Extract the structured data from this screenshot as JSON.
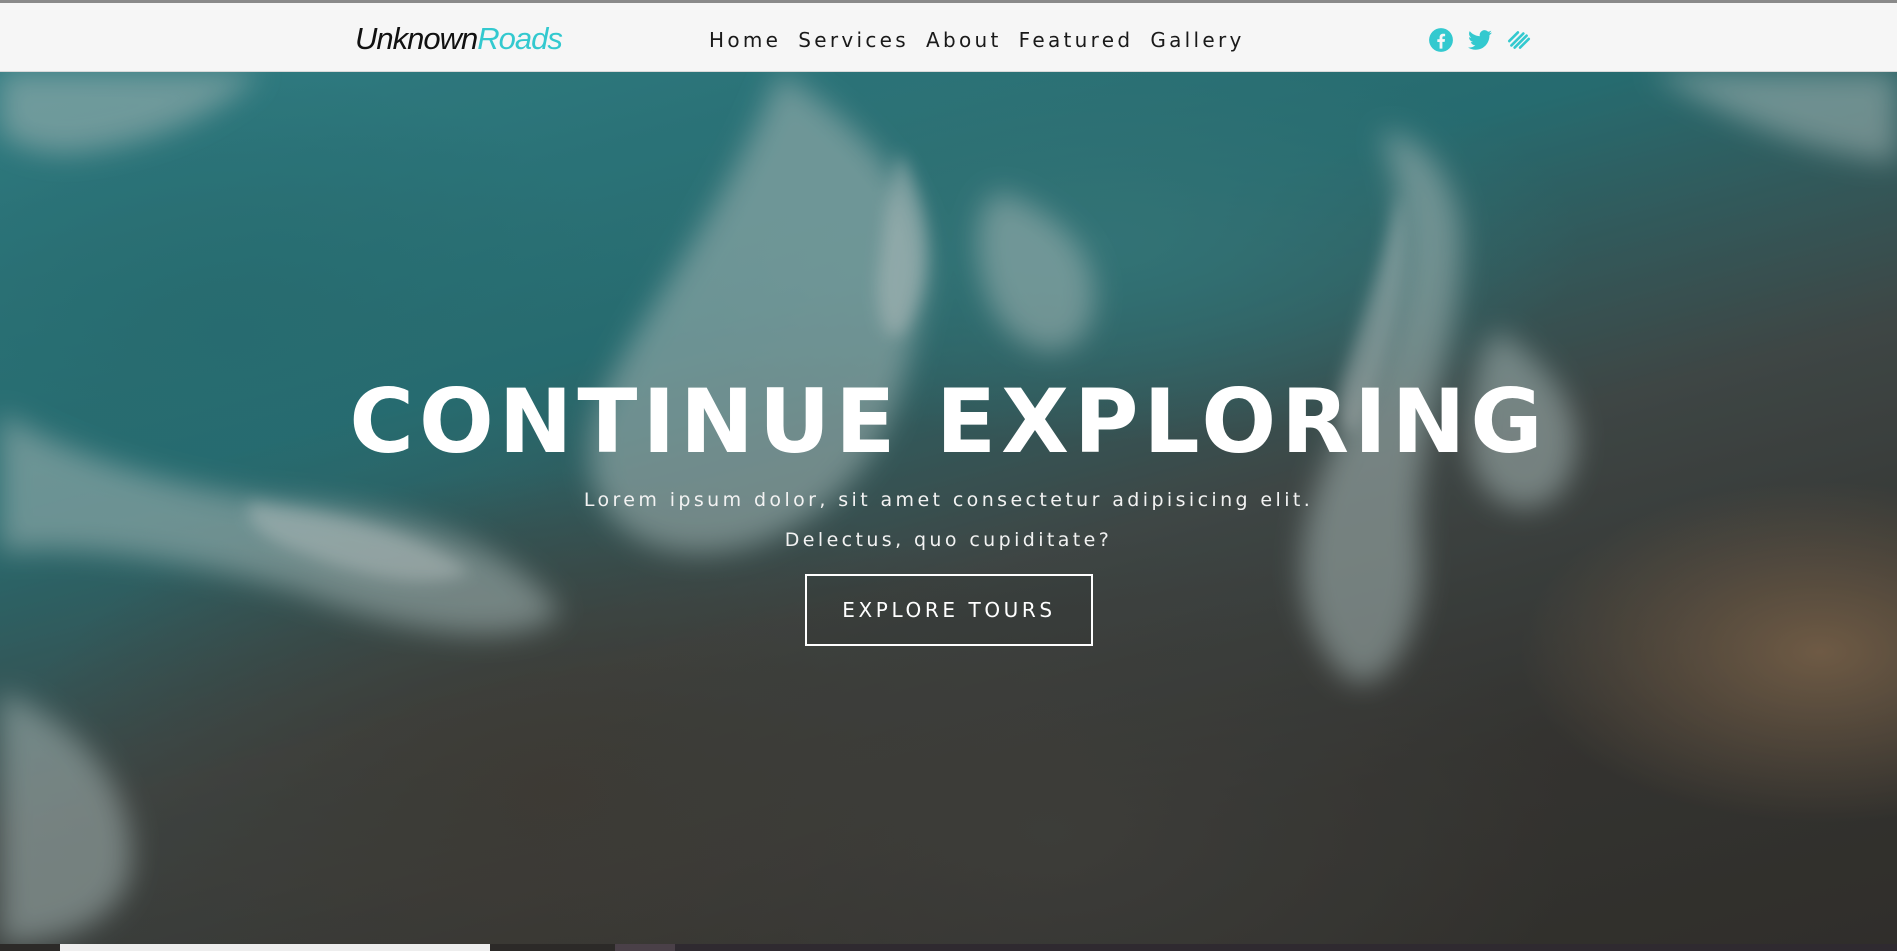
{
  "brand": {
    "part1": "Unknown",
    "part2": "Roads",
    "accent_color": "#33c9cf"
  },
  "nav": {
    "items": [
      {
        "label": "Home"
      },
      {
        "label": "Services"
      },
      {
        "label": "About"
      },
      {
        "label": "Featured"
      },
      {
        "label": "Gallery"
      }
    ]
  },
  "social": {
    "icons": [
      "facebook-icon",
      "twitter-icon",
      "stripes-icon"
    ],
    "color": "#33c9cf"
  },
  "hero": {
    "title": "CONTINUE EXPLORING",
    "subtitle_line1": "Lorem ipsum dolor, sit amet consectetur adipisicing elit.",
    "subtitle_line2": "Delectus, quo cupiditate?",
    "button_label": "EXPLORE TOURS"
  }
}
